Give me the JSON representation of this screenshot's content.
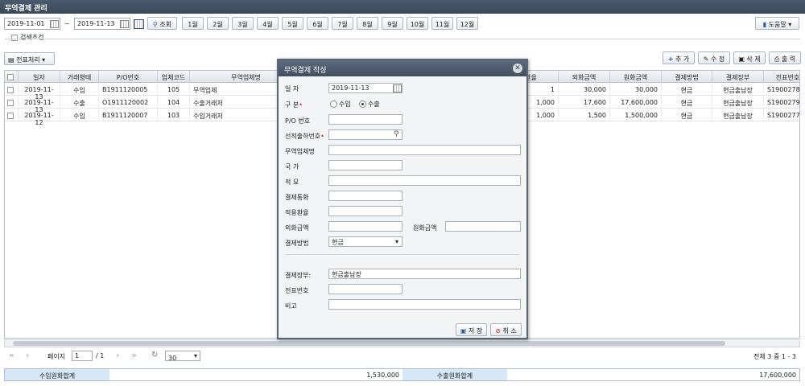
{
  "window": {
    "title": "무역결제 관리"
  },
  "toolbar": {
    "date_from": "2019-11-01",
    "tilde": "~",
    "date_to": "2019-11-13",
    "search_label": "조회",
    "months": [
      "1월",
      "2월",
      "3월",
      "4월",
      "5월",
      "6월",
      "7월",
      "8월",
      "9월",
      "10월",
      "11월",
      "12월"
    ],
    "help_label": "도움말"
  },
  "search_conditions": {
    "label": "검색조건"
  },
  "actions": {
    "slip_label": "전표처리",
    "add_label": "추 가",
    "edit_label": "수 정",
    "delete_label": "삭 제",
    "print_label": "출 력"
  },
  "grid": {
    "headers": [
      "일자",
      "거래형태",
      "P/O번호",
      "업체코드",
      "무역업체명",
      "환율",
      "외화금액",
      "원화금액",
      "결제방법",
      "결제장부",
      "전표번호"
    ],
    "rows": [
      [
        "2019-11-13",
        "수입",
        "B1911120005",
        "105",
        "무역업체",
        "1",
        "30,000",
        "30,000",
        "현금",
        "현금출납장",
        "S1900278"
      ],
      [
        "2019-11-13",
        "수출",
        "O1911120002",
        "104",
        "수출거래처",
        "1,000",
        "17,600",
        "17,600,000",
        "현금",
        "현금출납장",
        "S1900279"
      ],
      [
        "2019-11-12",
        "수입",
        "B1911120007",
        "103",
        "수입거래처",
        "1,000",
        "1,500",
        "1,500,000",
        "현금",
        "현금출납장",
        "S1900277"
      ]
    ]
  },
  "pager": {
    "page_label": "페이지",
    "page_value": "1",
    "page_total": "/ 1",
    "page_size": "30",
    "summary_text": "전체 3 중 1 - 3"
  },
  "summary": {
    "import_label": "수입원화합계",
    "import_value": "1,530,000",
    "export_label": "수출원화합계",
    "export_value": "17,600,000"
  },
  "modal": {
    "title": "무역결제 작성",
    "date_label": "일   자",
    "date_value": "2019-11-13",
    "type_label": "구   분",
    "type_import": "수입",
    "type_export": "수출",
    "po_label": "P/O 번호",
    "ship_label": "선적출하번호",
    "company_label": "무역업체명",
    "country_label": "국   가",
    "memo_label": "적   요",
    "currency_label": "결제통화",
    "rate_label": "적용환율",
    "foreign_label": "외화금액",
    "krw_label": "원화금액",
    "method_label": "결제방법",
    "method_value": "현금",
    "ledger_label": "결제장부:",
    "ledger_value": "현금출납장",
    "slip_label": "전표번호",
    "note_label": "비고",
    "save_label": "저 장",
    "cancel_label": "취 소"
  }
}
